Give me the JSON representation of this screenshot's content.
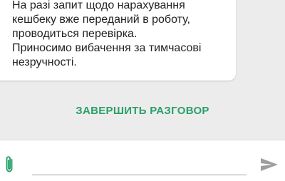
{
  "chat": {
    "message_text": "На разі запит щодо нарахування\nкешбеку вже переданий в роботу,\nпроводиться перевірка.\nПриносимо вибачення за тимчасові\nнезручності.",
    "end_conversation_label": "ЗАВЕРШИТЬ РАЗГОВОР"
  },
  "composer": {
    "input_value": "",
    "attach_icon": "paperclip-icon",
    "send_icon": "send-icon"
  },
  "colors": {
    "accent": "#2aa06a",
    "attach_icon": "#2aa06a",
    "send_icon": "#9e9e9e",
    "chat_background": "#ececec",
    "bubble_background": "#ffffff"
  }
}
